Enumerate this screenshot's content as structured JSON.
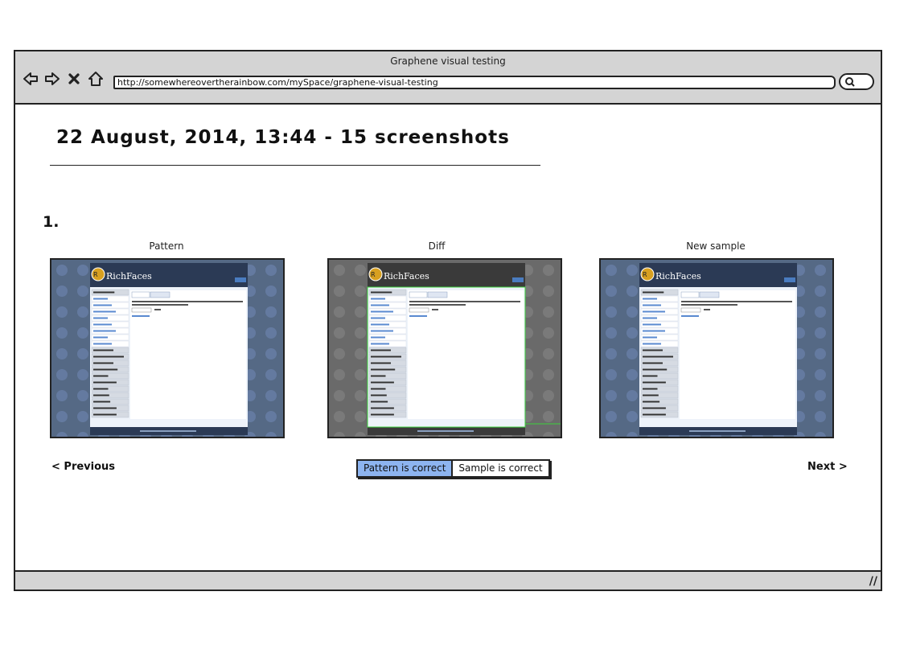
{
  "browser": {
    "title": "Graphene visual testing",
    "url": "http://somewhereovertherainbow.com/mySpace/graphene-visual-testing"
  },
  "heading": "22 August, 2014, 13:44  - 15 screenshots",
  "item_number": "1.",
  "columns": {
    "pattern": "Pattern",
    "diff": "Diff",
    "new_sample": "New sample"
  },
  "thumbnail": {
    "brand": "RichFaces",
    "sidebar_items": [
      "Ajax Action",
      "Ajax Queue",
      "Ajax Output/Containers",
      "Validation",
      "Data Iteration",
      "Trees",
      "Output/Panels",
      "Menus",
      "Inputs",
      "Selects",
      "Drag and Drop",
      "Miscellaneous"
    ],
    "tabs": [
      "Simple sample",
      "Dynamic Search"
    ]
  },
  "navigation": {
    "previous": "< Previous",
    "next": "Next  >"
  },
  "choice": {
    "pattern_correct": "Pattern is correct",
    "sample_correct": "Sample is correct"
  },
  "colors": {
    "selected_button": "#8db4f0",
    "chrome": "#d4d4d4",
    "diff_highlight": "#3cd23c"
  }
}
